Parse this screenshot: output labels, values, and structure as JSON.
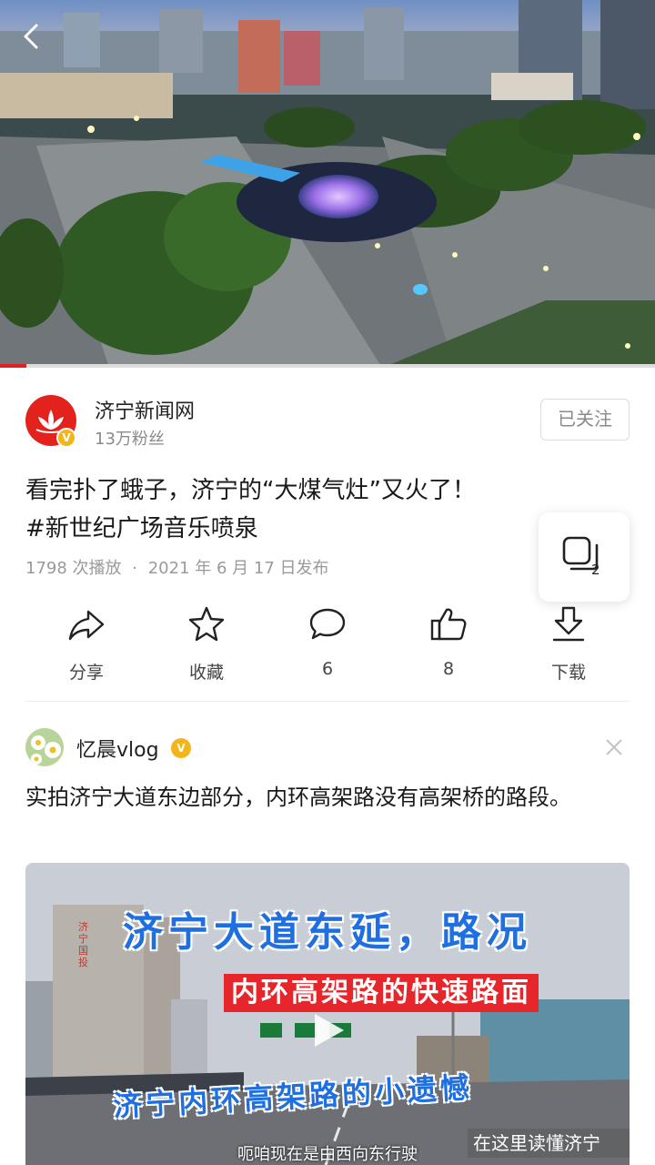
{
  "video": {
    "progress_percent": 4
  },
  "author": {
    "name": "济宁新闻网",
    "fans": "13万粉丝",
    "follow_label": "已关注",
    "avatar_icon": "lotus-logo-icon",
    "brand_color": "#e3221d"
  },
  "post": {
    "title_line1": "看完扑了蛾子，济宁的“大煤气灶”又火了！",
    "title_line2": "#新世纪广场音乐喷泉",
    "plays": "1798 次播放",
    "dot": "·",
    "date": "2021 年 6 月 17 日发布"
  },
  "collection": {
    "count": "2"
  },
  "actions": [
    {
      "icon": "share-icon",
      "label": "分享"
    },
    {
      "icon": "star-icon",
      "label": "收藏"
    },
    {
      "icon": "comment-icon",
      "label": "6"
    },
    {
      "icon": "thumbs-up-icon",
      "label": "8"
    },
    {
      "icon": "download-icon",
      "label": "下载"
    }
  ],
  "recommended": {
    "author": "忆晨vlog",
    "title": "实拍济宁大道东边部分，内环高架路没有高架桥的路段。",
    "thumb": {
      "line1": "济宁大道东延，路况",
      "line2": "内环高架路的快速路面",
      "line3": "济宁内环高架路的小遗憾",
      "subtitle": "呃咱现在是由西向东行驶",
      "watermark": "在这里读懂济宁",
      "building_sign": "济宁国投"
    }
  }
}
